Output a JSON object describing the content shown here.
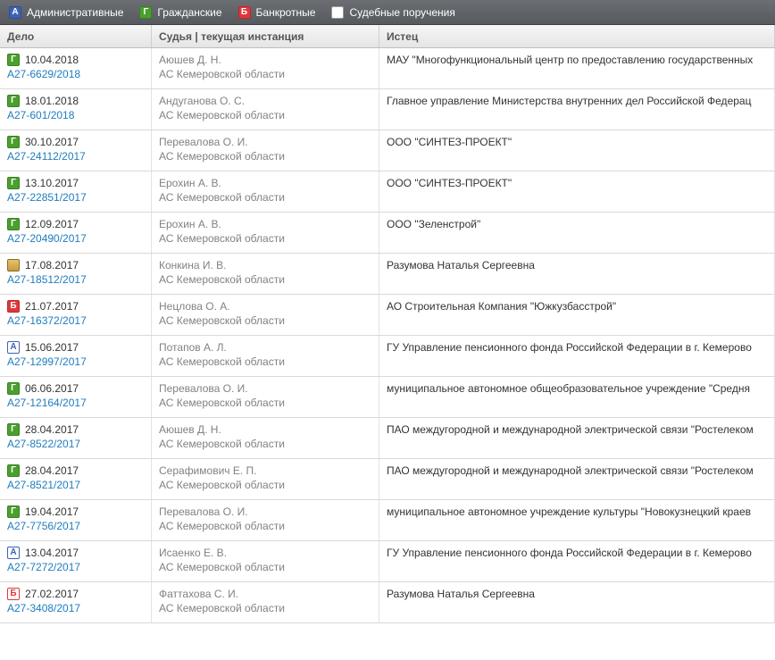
{
  "legend": {
    "admin": {
      "letter": "А",
      "label": "Административные"
    },
    "civil": {
      "letter": "Г",
      "label": "Гражданские"
    },
    "bankr": {
      "letter": "Б",
      "label": "Банкротные"
    },
    "assign": {
      "label": "Судебные поручения"
    }
  },
  "columns": {
    "case": "Дело",
    "judge": "Судья | текущая инстанция",
    "plaintiff": "Истец"
  },
  "court_default": "АС Кемеровской области",
  "rows": [
    {
      "icon": "g",
      "date": "10.04.2018",
      "case_no": "А27-6629/2018",
      "judge": "Аюшев Д. Н.",
      "plaintiff": "МАУ \"Многофункциональный центр по предоставлению государственных"
    },
    {
      "icon": "g",
      "date": "18.01.2018",
      "case_no": "А27-601/2018",
      "judge": "Андуганова О. С.",
      "plaintiff": "Главное управление Министерства внутренних дел Российской Федерац"
    },
    {
      "icon": "g",
      "date": "30.10.2017",
      "case_no": "А27-24112/2017",
      "judge": "Перевалова О. И.",
      "plaintiff": "ООО \"СИНТЕЗ-ПРОЕКТ\""
    },
    {
      "icon": "g",
      "date": "13.10.2017",
      "case_no": "А27-22851/2017",
      "judge": "Ерохин А. В.",
      "plaintiff": "ООО \"СИНТЕЗ-ПРОЕКТ\""
    },
    {
      "icon": "g",
      "date": "12.09.2017",
      "case_no": "А27-20490/2017",
      "judge": "Ерохин А. В.",
      "plaintiff": "ООО \"Зеленстрой\""
    },
    {
      "icon": "archive",
      "date": "17.08.2017",
      "case_no": "А27-18512/2017",
      "judge": "Конкина И. В.",
      "plaintiff": "Разумова Наталья Сергеевна"
    },
    {
      "icon": "b",
      "date": "21.07.2017",
      "case_no": "А27-16372/2017",
      "judge": "Нецлова О. А.",
      "plaintiff": "АО Строительная Компания \"Южкузбасстрой\""
    },
    {
      "icon": "a-outline",
      "date": "15.06.2017",
      "case_no": "А27-12997/2017",
      "judge": "Потапов А. Л.",
      "plaintiff": "ГУ Управление пенсионного фонда Российской Федерации в г. Кемерово"
    },
    {
      "icon": "g",
      "date": "06.06.2017",
      "case_no": "А27-12164/2017",
      "judge": "Перевалова О. И.",
      "plaintiff": "муниципальное автономное общеобразовательное учреждение \"Средня"
    },
    {
      "icon": "g",
      "date": "28.04.2017",
      "case_no": "А27-8522/2017",
      "judge": "Аюшев Д. Н.",
      "plaintiff": "ПАО междугородной и международной электрической связи \"Ростелеком"
    },
    {
      "icon": "g",
      "date": "28.04.2017",
      "case_no": "А27-8521/2017",
      "judge": "Серафимович Е. П.",
      "plaintiff": "ПАО междугородной и международной электрической связи \"Ростелеком"
    },
    {
      "icon": "g",
      "date": "19.04.2017",
      "case_no": "А27-7756/2017",
      "judge": "Перевалова О. И.",
      "plaintiff": "муниципальное автономное учреждение культуры \"Новокузнецкий краев"
    },
    {
      "icon": "a-outline",
      "date": "13.04.2017",
      "case_no": "А27-7272/2017",
      "judge": "Исаенко Е. В.",
      "plaintiff": "ГУ Управление пенсионного фонда Российской Федерации в г. Кемерово"
    },
    {
      "icon": "b-outline",
      "date": "27.02.2017",
      "case_no": "А27-3408/2017",
      "judge": "Фаттахова С. И.",
      "plaintiff": "Разумова Наталья Сергеевна"
    }
  ],
  "last_row_court": "АС Кемеровской области"
}
